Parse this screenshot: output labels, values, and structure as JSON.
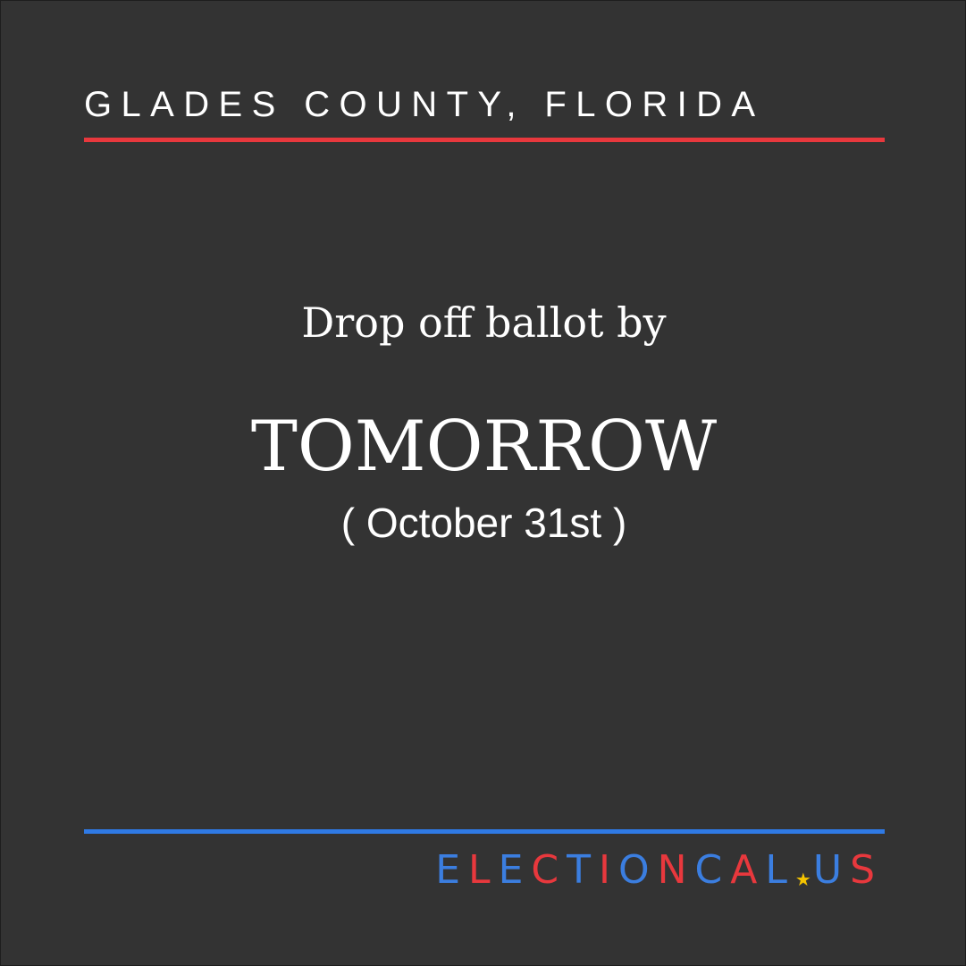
{
  "header": {
    "county": "GLADES COUNTY, FLORIDA"
  },
  "message": {
    "lead": "Drop off ballot by",
    "deadline": "TOMORROW",
    "date": "( October 31st )"
  },
  "logo": {
    "text": "ELECTIONCAL.US",
    "letters": [
      "E",
      "L",
      "E",
      "C",
      "T",
      "I",
      "O",
      "N",
      "C",
      "A",
      "L",
      "★",
      "U",
      "S"
    ]
  },
  "colors": {
    "background": "#333333",
    "accent_red": "#e8383d",
    "accent_blue": "#2f7ae5",
    "star_yellow": "#f5c400",
    "text": "#ffffff"
  }
}
